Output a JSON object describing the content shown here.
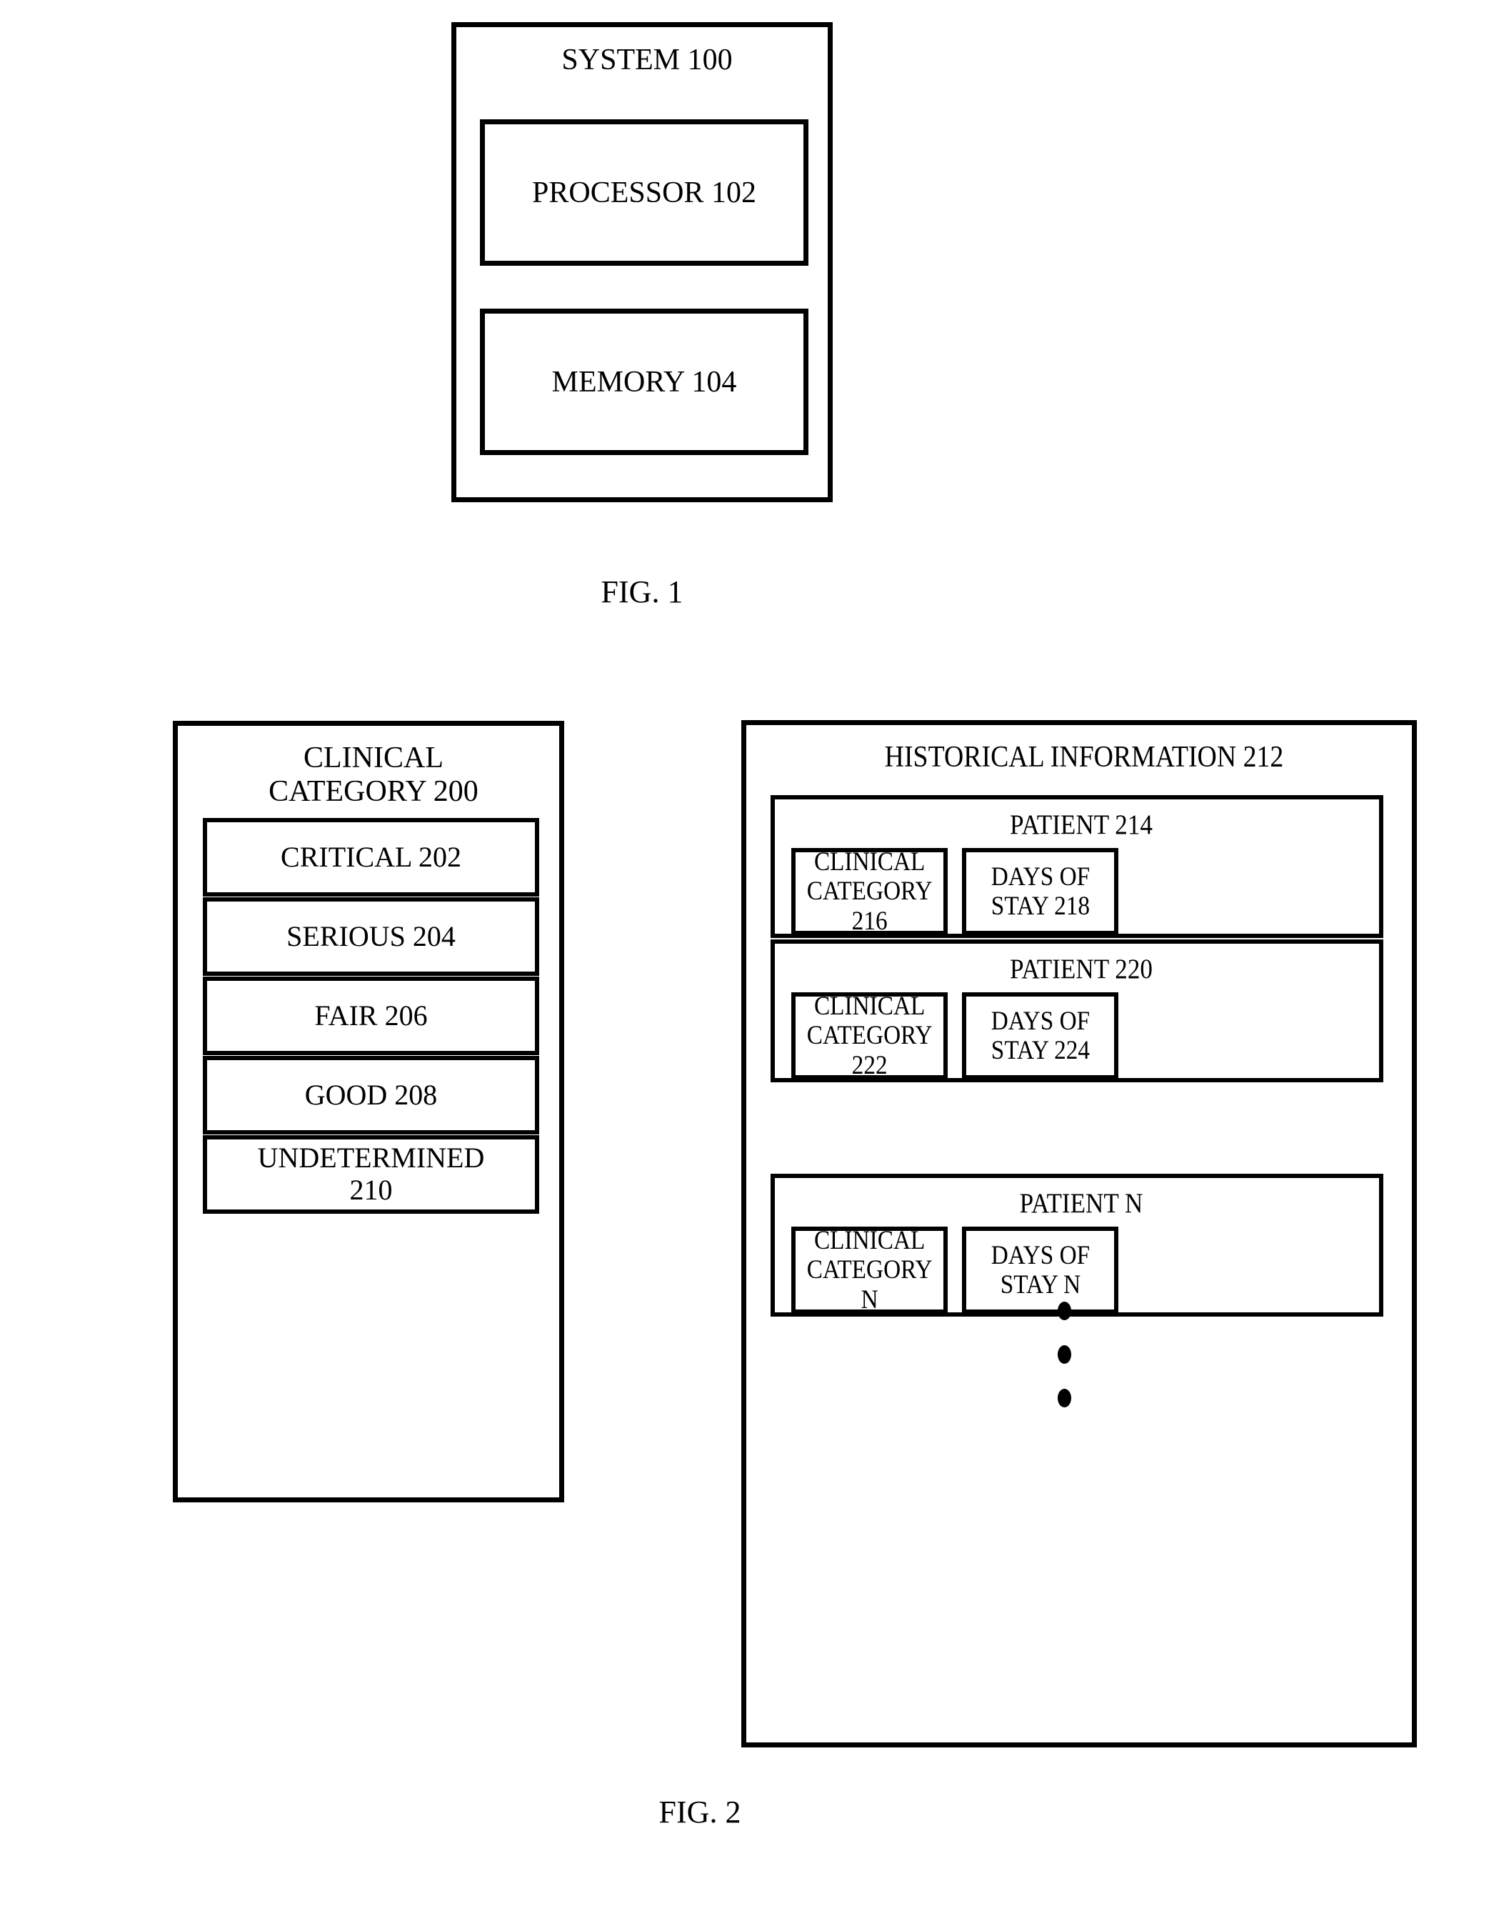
{
  "figures": [
    {
      "caption": "FIG. 1",
      "system": {
        "title": "SYSTEM 100",
        "components": [
          {
            "label": "PROCESSOR 102"
          },
          {
            "label": "MEMORY 104"
          }
        ]
      }
    },
    {
      "caption": "FIG. 2",
      "clinical_category": {
        "title": "CLINICAL\nCATEGORY 200",
        "items": [
          {
            "label": "CRITICAL 202"
          },
          {
            "label": "SERIOUS 204"
          },
          {
            "label": "FAIR 206"
          },
          {
            "label": "GOOD 208"
          },
          {
            "label": "UNDETERMINED\n210"
          }
        ]
      },
      "historical_information": {
        "title": "HISTORICAL INFORMATION 212",
        "patients": [
          {
            "title": "PATIENT 214",
            "clinical_category_label": "CLINICAL\nCATEGORY\n216",
            "days_of_stay_label": "DAYS OF\nSTAY 218"
          },
          {
            "title": "PATIENT 220",
            "clinical_category_label": "CLINICAL\nCATEGORY\n222",
            "days_of_stay_label": "DAYS OF\nSTAY 224"
          },
          {
            "title": "PATIENT N",
            "clinical_category_label": "CLINICAL\nCATEGORY\nN",
            "days_of_stay_label": "DAYS OF\nSTAY N"
          }
        ],
        "ellipsis": {
          "glyph": "vertical-ellipsis",
          "dot_count": 3
        }
      }
    }
  ],
  "style": {
    "line_color": "#000000",
    "background_color": "#ffffff"
  }
}
